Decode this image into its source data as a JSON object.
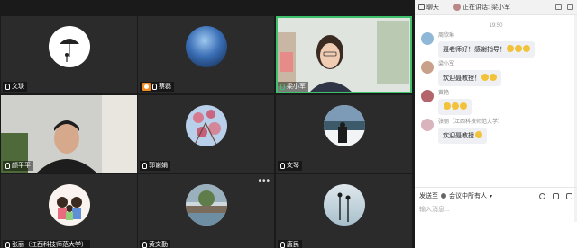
{
  "tiles": [
    {
      "name": "文琰"
    },
    {
      "name": "蔡磊"
    },
    {
      "name": "梁小军"
    },
    {
      "name": "颜平平"
    },
    {
      "name": "郭谢娟"
    },
    {
      "name": "文琴"
    },
    {
      "name": "张丽（江西科技师范大学）"
    },
    {
      "name": "黄文勤"
    },
    {
      "name": "唐民"
    }
  ],
  "chat": {
    "tab_label": "聊天",
    "speaking_label": "正在讲话:",
    "speaking_name": "梁小军",
    "time": "19:50",
    "messages": [
      {
        "sender": "周欣琳",
        "text": "聂老师好！感谢指导！"
      },
      {
        "sender": "梁小军",
        "text": "欢迎聂教授！"
      },
      {
        "sender": "黄艳",
        "text": ""
      },
      {
        "sender": "张丽（江西科技师范大学）",
        "text": "欢迎聂教授"
      }
    ],
    "send_to_label": "发送至",
    "recipient": "会议中所有人",
    "input_placeholder": "输入消息..."
  }
}
